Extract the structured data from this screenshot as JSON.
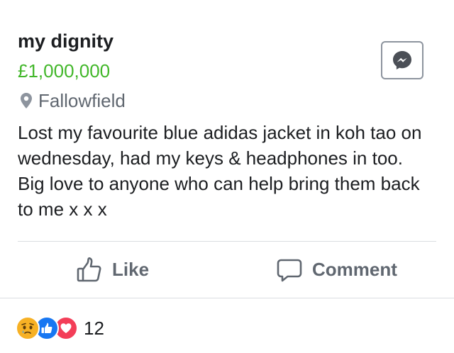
{
  "listing": {
    "title": "my dignity",
    "price": "£1,000,000",
    "location": "Fallowfield",
    "description": "Lost my favourite blue adidas jacket in koh tao on wednesday, had my keys & headphones in too. Big love to anyone who can help bring them back to me x x x"
  },
  "actions": {
    "like_label": "Like",
    "comment_label": "Comment"
  },
  "reactions": {
    "icons": [
      "sad-icon",
      "like-icon",
      "love-icon"
    ],
    "count": "12"
  },
  "colors": {
    "price": "#42b72a",
    "secondary_text": "#606770",
    "like_blue": "#1877f2",
    "love_red": "#f33e58",
    "sad_yellow": "#f7b125"
  }
}
